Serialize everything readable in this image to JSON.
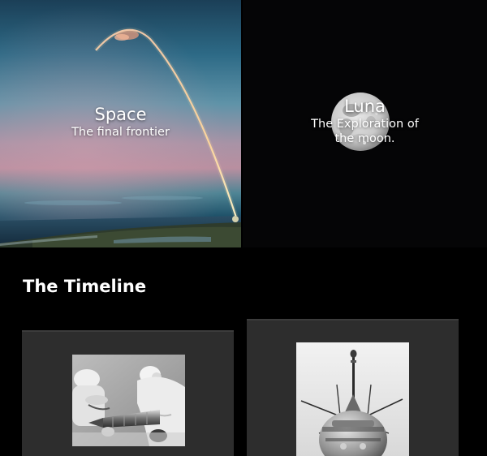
{
  "hero": {
    "space": {
      "title": "Space",
      "subtitle": "The final frontier"
    },
    "luna": {
      "title": "Luna",
      "subtitle": "The Exploration of the moon."
    }
  },
  "timeline": {
    "heading": "The Timeline"
  },
  "colors": {
    "background": "#000000",
    "card_background": "#2d2d2d",
    "text": "#ffffff"
  }
}
